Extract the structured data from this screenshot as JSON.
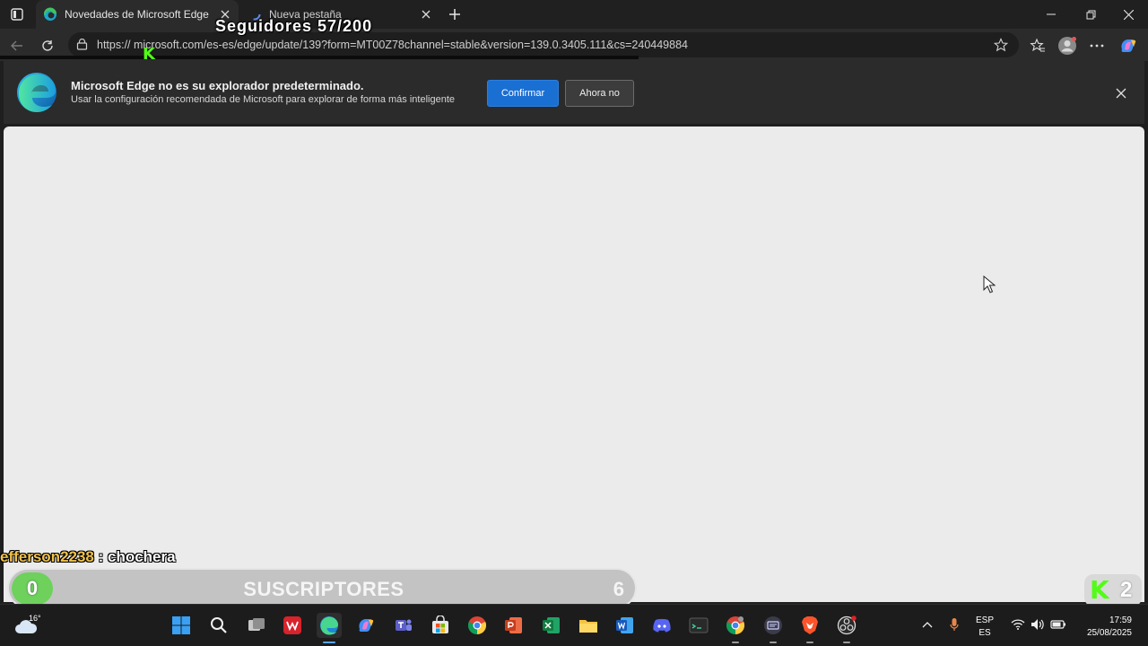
{
  "tabs": [
    {
      "title": "Novedades de Microsoft Edge",
      "active": true
    },
    {
      "title": "Nueva pestaña",
      "active": false
    }
  ],
  "address": {
    "url": "https:// microsoft.com/es-es/edge/update/139?form=MT00Z78channel=stable&version=139.0.3405.111&cs=240449884"
  },
  "overlay": {
    "followers": "Seguidores 57/200"
  },
  "infobar": {
    "title": "Microsoft Edge no es su explorador predeterminado.",
    "subtitle": "Usar la configuración recomendada de Microsoft para explorar de forma más inteligente",
    "confirm_label": "Confirmar",
    "not_now_label": "Ahora no"
  },
  "stream": {
    "chat": {
      "user": "efferson2238",
      "separator": " : ",
      "message": "chochera"
    },
    "subs": {
      "left_value": "0",
      "label": "SUSCRIPTORES",
      "count": "6"
    },
    "kick": {
      "letter": "K",
      "count": "2"
    }
  },
  "taskbar": {
    "weather_temp": "16°",
    "lang_line1": "ESP",
    "lang_line2": "ES",
    "time": "17:59",
    "date": "25/08/2025"
  },
  "colors": {
    "accent": "#1a6fd3",
    "kick_green": "#53fc18",
    "subs_green": "#6dd15c",
    "chat_user": "#f0c24a"
  }
}
